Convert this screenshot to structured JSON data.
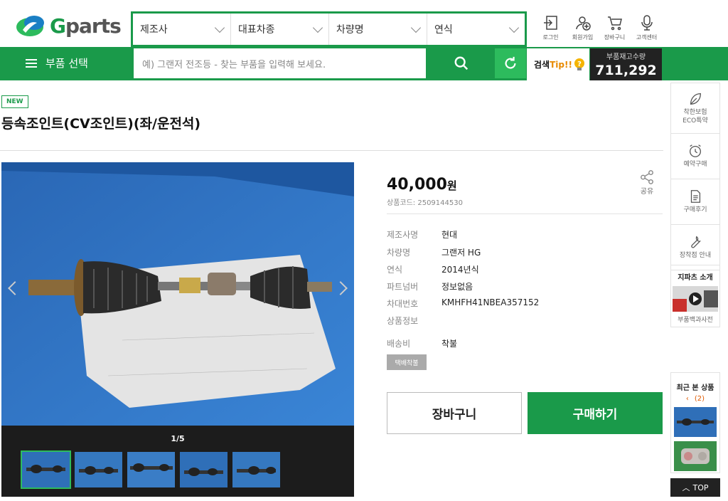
{
  "header": {
    "logo_text": "Gparts",
    "filters": [
      "제조사",
      "대표차종",
      "차량명",
      "연식"
    ],
    "top_icons": [
      {
        "label": "로그인",
        "icon": "login-icon"
      },
      {
        "label": "회원가입",
        "icon": "join-icon"
      },
      {
        "label": "장바구니",
        "icon": "cart-icon"
      },
      {
        "label": "고객센터",
        "icon": "mic-icon"
      }
    ],
    "menu_label": "부품 선택",
    "search_placeholder": "예) 그랜저 전조등 - 찾는 부품을 입력해 보세요.",
    "tip_label": "검색",
    "tip_highlight": "Tip!!",
    "stock_label": "부품재고수량",
    "stock_value": "711,292"
  },
  "product": {
    "badge": "NEW",
    "title": "등속조인트(CV조인트)(좌/운전석)",
    "price": "40,000",
    "price_unit": "원",
    "code": "상품코드: 2509144530",
    "share_label": "공유",
    "specs": [
      {
        "key": "제조사명",
        "value": "현대"
      },
      {
        "key": "차량명",
        "value": "그랜저 HG"
      },
      {
        "key": "연식",
        "value": "2014년식"
      },
      {
        "key": "파트넘버",
        "value": "정보없음"
      },
      {
        "key": "차대번호",
        "value": "KMHFH41NBEA357152"
      },
      {
        "key": "상품정보",
        "value": ""
      }
    ],
    "shipping_key": "배송비",
    "shipping_value": "착불",
    "shipping_badge": "택배착불",
    "cart_button": "장바구니",
    "buy_button": "구매하기"
  },
  "gallery": {
    "counter": "1/5",
    "thumb_count": 5
  },
  "sidebar": {
    "items": [
      {
        "label": "착한보험\nECO특약",
        "icon": "leaf-icon"
      },
      {
        "label": "예약구매",
        "icon": "alarm-clock-icon"
      },
      {
        "label": "구매후기",
        "icon": "document-icon"
      },
      {
        "label": "장착점 안내",
        "icon": "wrench-icon"
      }
    ],
    "video_title": "지파츠 소개",
    "video_caption": "부품백과사전",
    "recent_title": "최근 본 상품",
    "recent_count": "(2)",
    "top_button": "TOP"
  },
  "colors": {
    "brand_green": "#1a9a4a",
    "accent_green": "#2dbb5d",
    "dark": "#222222"
  }
}
